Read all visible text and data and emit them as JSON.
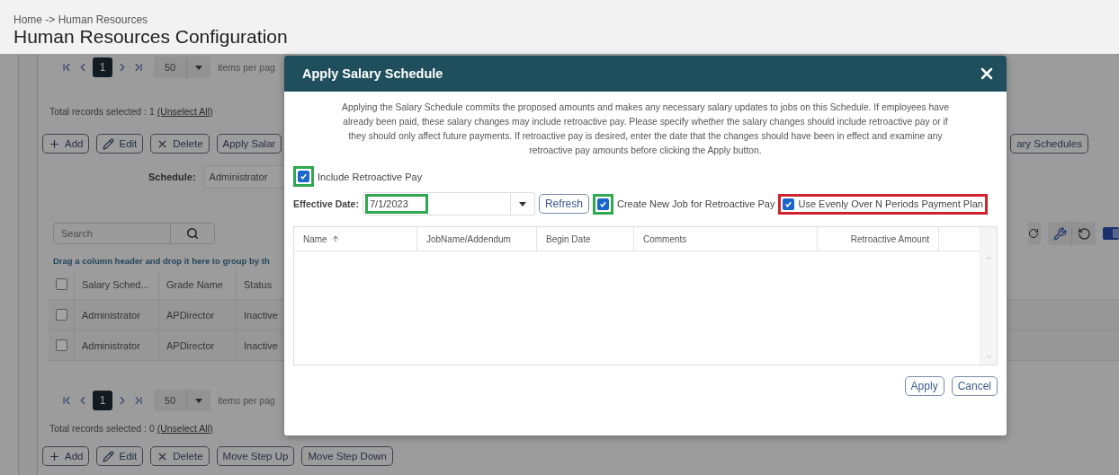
{
  "breadcrumb": "Home -> Human Resources",
  "title": "Human Resources Configuration",
  "top_pager": {
    "pages": [
      {
        "label": "1",
        "selected": true
      }
    ],
    "page_size": "50",
    "items_label": "items per pag"
  },
  "top_selection": {
    "text": "Total records selected : 1",
    "link": "(Unselect All)"
  },
  "top_buttons": [
    {
      "kind": "add",
      "label": "Add"
    },
    {
      "kind": "edit",
      "label": "Edit"
    },
    {
      "kind": "delete",
      "label": "Delete"
    },
    {
      "kind": "text",
      "label": "Apply Salar"
    }
  ],
  "right_button": "ary Schedules",
  "schedule": {
    "label": "Schedule:",
    "value": "Administrator"
  },
  "search": {
    "placeholder": "Search"
  },
  "group_hint": "Drag a column header and drop it here to group by th",
  "grid": {
    "select_all": {
      "checked": false
    },
    "columns": [
      "Salary Sched...",
      "Grade Name",
      "Status"
    ],
    "rows": [
      {
        "checked": false,
        "cells": [
          "Administrator",
          "APDirector",
          "Inactive"
        ]
      },
      {
        "checked": false,
        "cells": [
          "Administrator",
          "APDirector",
          "Inactive"
        ]
      }
    ]
  },
  "bottom_pager": {
    "pages": [
      {
        "label": "1",
        "selected": true
      }
    ],
    "page_size": "50",
    "items_label": "items per pag"
  },
  "bottom_selection": {
    "text": "Total records selected : 0",
    "link": "(Unselect All)"
  },
  "bottom_buttons": [
    {
      "kind": "add",
      "label": "Add"
    },
    {
      "kind": "edit",
      "label": "Edit"
    },
    {
      "kind": "delete",
      "label": "Delete"
    },
    {
      "kind": "text",
      "label": "Move Step Up"
    },
    {
      "kind": "text",
      "label": "Move Step Down"
    }
  ],
  "dialog": {
    "title": "Apply Salary Schedule",
    "message": "Applying the Salary Schedule commits the proposed amounts and makes any necessary salary updates to jobs on this Schedule. If employees have already been paid, these salary changes may include retroactive pay. Please specify whether the salary changes should include retroactive pay or if they should only affect future payments. If retroactive pay is desired, enter the date that the changes should have been in effect and examine any retroactive pay amounts before clicking the Apply button.",
    "include_retro": {
      "label": "Include Retroactive Pay",
      "checked": true,
      "color": "#2fa84f"
    },
    "effective_date": {
      "label": "Effective Date:",
      "value": "7/1/2023",
      "color": "#2fa84f"
    },
    "refresh": "Refresh",
    "options": [
      {
        "kind": "boxmark",
        "label": "Create New Job for Retroactive Pay",
        "checked": true,
        "color": "#2fa84f"
      },
      {
        "kind": "rowmark",
        "label": "Use Evenly Over N Periods Payment Plan",
        "checked": true,
        "color": "#d0212c"
      }
    ],
    "columns": [
      {
        "label": "Name",
        "sorted": true
      },
      {
        "label": "JobName/Addendum",
        "sorted": false
      },
      {
        "label": "Begin Date",
        "sorted": false
      },
      {
        "label": "Comments",
        "sorted": false
      },
      {
        "label": "Retroactive Amount",
        "sorted": false
      }
    ],
    "buttons": [
      "Apply",
      "Cancel"
    ]
  }
}
